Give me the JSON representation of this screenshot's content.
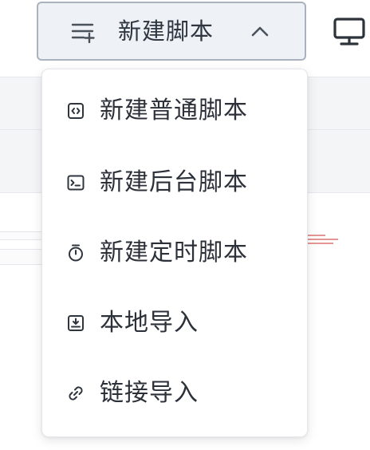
{
  "toolbar": {
    "new_script_label": "新建脚本",
    "new_script_icon": "list-add-icon",
    "caret_icon": "chevron-up-icon",
    "monitor_icon": "monitor-icon"
  },
  "dropdown": {
    "items": [
      {
        "label": "新建普通脚本",
        "icon": "code-file-icon"
      },
      {
        "label": "新建后台脚本",
        "icon": "terminal-icon"
      },
      {
        "label": "新建定时脚本",
        "icon": "stopwatch-icon"
      },
      {
        "label": "本地导入",
        "icon": "import-box-icon"
      },
      {
        "label": "链接导入",
        "icon": "link-icon"
      }
    ]
  },
  "colors": {
    "button_bg": "#eef1f5",
    "button_border": "#a9b2bd",
    "text": "#2c3038",
    "menu_bg": "#ffffff"
  }
}
